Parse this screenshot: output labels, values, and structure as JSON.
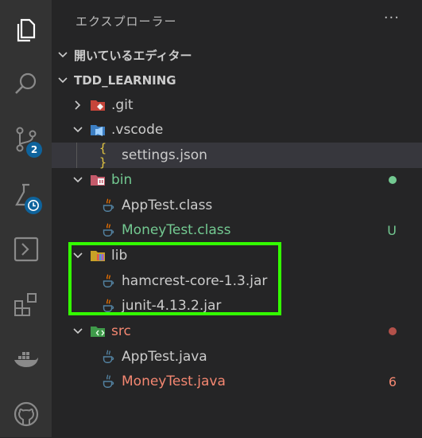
{
  "explorer": {
    "title": "エクスプローラー",
    "more": "···",
    "open_editors_label": "開いているエディター",
    "project_label": "TDD_LEARNING"
  },
  "activity_bar": {
    "scm_badge": "2"
  },
  "tree": [
    {
      "name": ".git",
      "type": "folder",
      "expanded": false,
      "status": "",
      "color": "#cccccc"
    },
    {
      "name": ".vscode",
      "type": "folder",
      "expanded": true,
      "status": "",
      "color": "#cccccc"
    },
    {
      "name": "settings.json",
      "type": "json",
      "status": "",
      "color": "#cccccc"
    },
    {
      "name": "bin",
      "type": "folder",
      "expanded": true,
      "status": "",
      "color": "#73c991"
    },
    {
      "name": "AppTest.class",
      "type": "java",
      "status": "",
      "color": "#cccccc"
    },
    {
      "name": "MoneyTest.class",
      "type": "java",
      "status": "U",
      "color": "#73c991"
    },
    {
      "name": "lib",
      "type": "folder",
      "expanded": true,
      "status": "",
      "color": "#cccccc"
    },
    {
      "name": "hamcrest-core-1.3.jar",
      "type": "java",
      "status": "",
      "color": "#cccccc"
    },
    {
      "name": "junit-4.13.2.jar",
      "type": "java",
      "status": "",
      "color": "#cccccc"
    },
    {
      "name": "src",
      "type": "folder",
      "expanded": true,
      "status": "",
      "color": "#f48771"
    },
    {
      "name": "AppTest.java",
      "type": "java",
      "status": "",
      "color": "#cccccc"
    },
    {
      "name": "MoneyTest.java",
      "type": "java",
      "status": "6",
      "color": "#f48771"
    }
  ],
  "colors": {
    "activity_bg": "#333333",
    "sidebar_bg": "#252526",
    "selected_bg": "#37373d",
    "untracked_green": "#73c991",
    "error_red": "#f48771",
    "highlight_green": "#33ff00",
    "badge_blue": "#0e639c"
  }
}
